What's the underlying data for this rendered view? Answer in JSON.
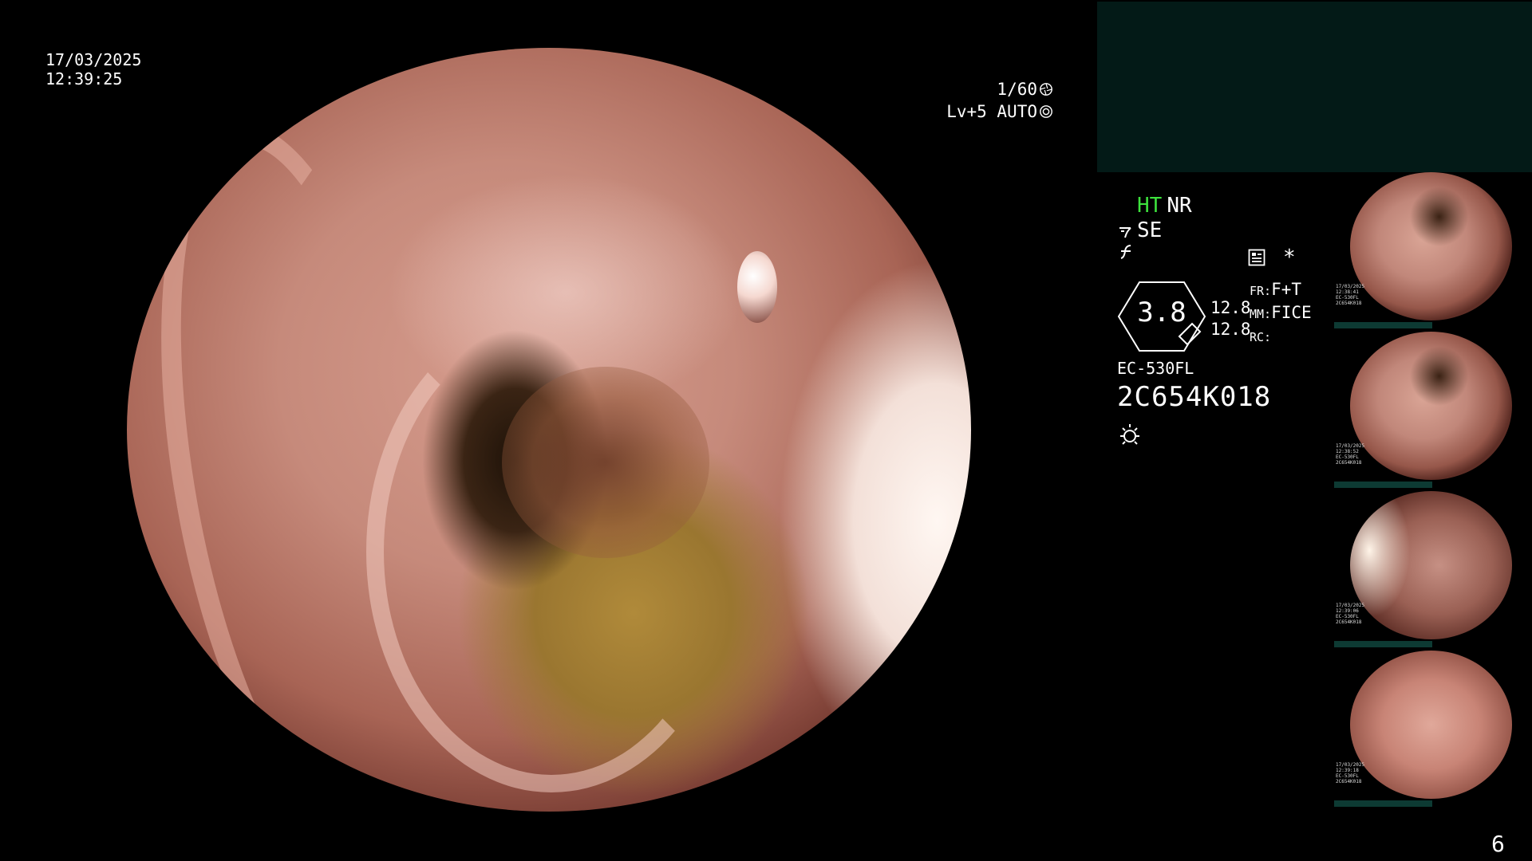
{
  "datetime": {
    "date": "17/03/2025",
    "time": "12:39:25"
  },
  "camera": {
    "shutter": "1/60",
    "level": "Lv+5 AUTO"
  },
  "indicators": {
    "ht": "HT",
    "nr": "NR",
    "se": "SE"
  },
  "dial": {
    "value": "3.8"
  },
  "readings": {
    "r1": "12.8",
    "r2": "12.8"
  },
  "modes": {
    "fr_label": "FR:",
    "fr_value": "F+T",
    "mm_label": "MM:",
    "mm_value": "FICE",
    "rc_label": "RC:"
  },
  "scope": {
    "model": "EC-530FL",
    "serial": "2C654K018"
  },
  "marks": {
    "asterisk": "*"
  },
  "thumbnails": [
    {
      "meta": "17/03/2025\n12:38:41\nEC-530FL\n2C654K018"
    },
    {
      "meta": "17/03/2025\n12:38:52\nEC-530FL\n2C654K018"
    },
    {
      "meta": "17/03/2025\n12:39:06\nEC-530FL\n2C654K018"
    },
    {
      "meta": "17/03/2025\n12:39:18\nEC-530FL\n2C654K018"
    }
  ],
  "page_number": "6",
  "colors": {
    "indicator_green": "#3de23d",
    "panel_teal": "#031a17",
    "thumb_bar": "#0d3a33"
  },
  "icons": [
    "aperture-icon",
    "auto-exposure-icon",
    "se-signal-icon",
    "filter-icon",
    "record-icon",
    "light-icon"
  ]
}
